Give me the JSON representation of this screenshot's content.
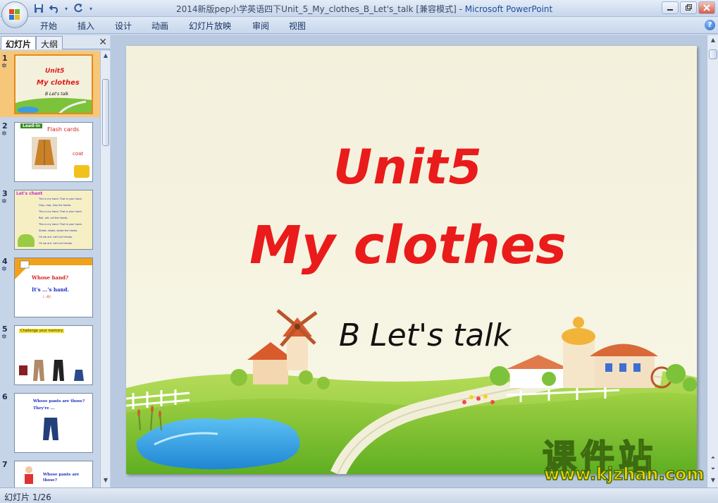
{
  "window": {
    "title": "2014新版pep小学英语四下Unit_5_My_clothes_B_Let's_talk [兼容模式] - ",
    "app_name": "Microsoft PowerPoint"
  },
  "quick_access": {
    "save_icon": "save-icon",
    "undo_icon": "undo-icon",
    "redo_icon": "redo-icon"
  },
  "ribbon": {
    "tabs": [
      "开始",
      "插入",
      "设计",
      "动画",
      "幻灯片放映",
      "审阅",
      "视图"
    ]
  },
  "left_pane": {
    "tabs": [
      "幻灯片",
      "大纲"
    ],
    "close_glyph": "✕",
    "star_glyph": "✲",
    "slides": [
      {
        "num": "1",
        "lines": [
          "Unit5",
          "My clothes",
          "B Let's talk"
        ]
      },
      {
        "num": "2",
        "lines": [
          "Lead-in",
          "Flash cards",
          "coat"
        ]
      },
      {
        "num": "3",
        "lines": [
          "Let's chant",
          "This is my hand. That is your hand.",
          "Clap, clap, clap the hands.",
          "This is my hand. That is your hand.",
          "Roll, roll, roll the hands.",
          "This is my hand. That is your hand.",
          "Shake, shake, shake the hands.",
          "Oh we are. Let's be friends.",
          "Oh we are. Let's be friends."
        ]
      },
      {
        "num": "4",
        "lines": [
          "Whose hand?",
          "It's ...'s hand.",
          "(...的)"
        ]
      },
      {
        "num": "5",
        "lines": [
          "Challenge your memory"
        ]
      },
      {
        "num": "6",
        "lines": [
          "Whose pants are those?",
          "They're ..."
        ]
      },
      {
        "num": "7",
        "lines": [
          "Whose pants are",
          "those?"
        ]
      }
    ]
  },
  "slide": {
    "title_line1": "Unit5",
    "title_line2": "My clothes",
    "subtitle": "B Let's talk"
  },
  "watermark": {
    "chars": "课件站",
    "url": "www.kjzhan.com"
  },
  "status": {
    "text": "幻灯片 1/26"
  },
  "colors": {
    "title_red": "#ea1b1b",
    "selected_thumb": "#f6c779",
    "watermark_yellow": "#f8d200"
  }
}
